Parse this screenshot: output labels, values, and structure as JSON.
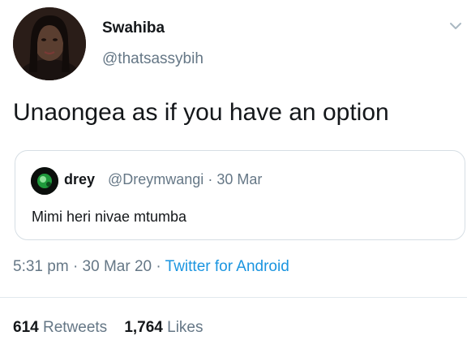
{
  "author": {
    "display_name": "Swahiba",
    "handle": "@thatsassybih",
    "avatar_icon": "profile-photo"
  },
  "tweet": {
    "text": "Unaongea as if you have an option"
  },
  "quoted_tweet": {
    "display_name": "drey",
    "handle": "@Dreymwangi",
    "separator": "·",
    "date": "30 Mar",
    "text": "Mimi heri nivae mtumba",
    "avatar_icon": "profile-photo"
  },
  "meta": {
    "time": "5:31 pm",
    "separator": "·",
    "date": "30 Mar 20",
    "source": "Twitter for Android"
  },
  "stats": {
    "retweets_count": "614",
    "retweets_label": "Retweets",
    "likes_count": "1,764",
    "likes_label": "Likes"
  },
  "colors": {
    "text": "#14171a",
    "secondary": "#657786",
    "link": "#1b95e0",
    "border": "#d6dee4"
  }
}
